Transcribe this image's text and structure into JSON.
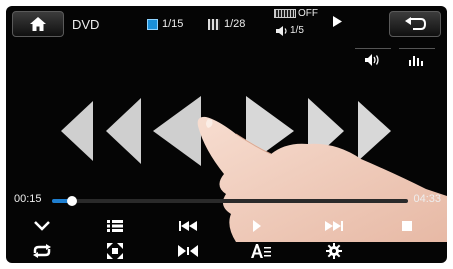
{
  "header": {
    "source_label": "DVD",
    "chapter": "1/15",
    "title": "1/28",
    "subtitle_status": "OFF",
    "audio_track": "1/5"
  },
  "icons": {
    "home": "home-icon",
    "back": "back-icon",
    "chapter": "chapter-icon",
    "title": "title-icon",
    "subtitle": "subtitle-icon",
    "audio": "speaker-icon",
    "playing": "play-icon",
    "volume": "volume-icon",
    "equalizer": "equalizer-icon",
    "rewind": "rewind-arrows-icon",
    "forward": "forward-arrows-icon"
  },
  "playback": {
    "current_time": "00:15",
    "total_time": "04:33",
    "progress": 0.055
  },
  "controls": {
    "row1": [
      "chevron-down-icon",
      "playlist-icon",
      "previous-icon",
      "play-pause-icon",
      "next-icon",
      "stop-icon"
    ],
    "row2": [
      "repeat-icon",
      "zoom-icon",
      "angle-icon",
      "text-size-icon",
      "settings-icon"
    ]
  },
  "colors": {
    "background": "#050505",
    "accent": "#1f7fd0",
    "arrow_fill": "#cfcfcf"
  }
}
